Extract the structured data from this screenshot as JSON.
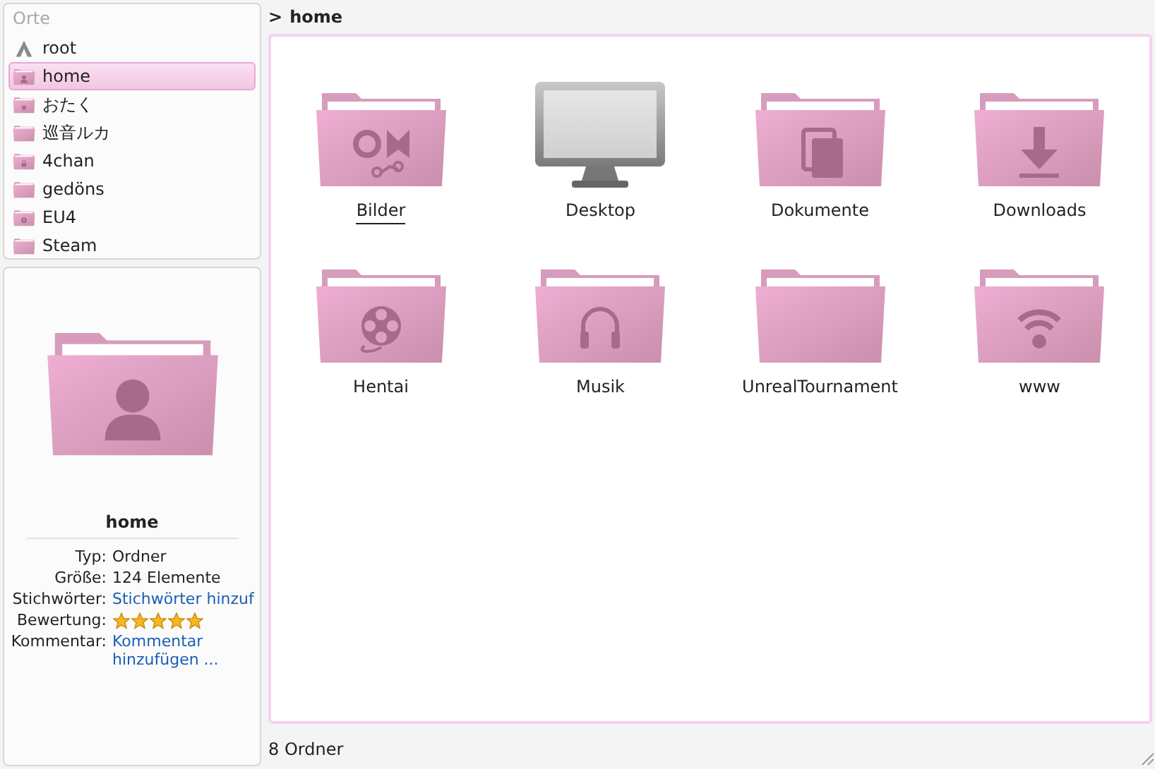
{
  "places": {
    "title": "Orte",
    "items": [
      {
        "label": "root",
        "kind": "drive",
        "selected": false
      },
      {
        "label": "home",
        "kind": "home",
        "selected": true
      },
      {
        "label": "おたく",
        "kind": "star",
        "selected": false
      },
      {
        "label": "巡音ルカ",
        "kind": "plain",
        "selected": false
      },
      {
        "label": "4chan",
        "kind": "lock",
        "selected": false
      },
      {
        "label": "gedöns",
        "kind": "plain",
        "selected": false
      },
      {
        "label": "EU4",
        "kind": "disc",
        "selected": false
      },
      {
        "label": "Steam",
        "kind": "plain",
        "selected": false
      }
    ]
  },
  "info": {
    "title": "home",
    "kind": "home",
    "rows": [
      {
        "label": "Typ:",
        "kind": "text",
        "value": "Ordner"
      },
      {
        "label": "Größe:",
        "kind": "text",
        "value": "124 Elemente"
      },
      {
        "label": "Stichwörter:",
        "kind": "link",
        "value": "Stichwörter hinzuf"
      },
      {
        "label": "Bewertung:",
        "kind": "stars",
        "stars": 5
      },
      {
        "label": "Kommentar:",
        "kind": "link",
        "value": "Kommentar hinzufügen ..."
      }
    ]
  },
  "breadcrumb": {
    "separator": ">",
    "path": "home"
  },
  "items": [
    {
      "label": "Bilder",
      "kind": "pictures",
      "focused": true
    },
    {
      "label": "Desktop",
      "kind": "desktop",
      "focused": false
    },
    {
      "label": "Dokumente",
      "kind": "documents",
      "focused": false
    },
    {
      "label": "Downloads",
      "kind": "downloads",
      "focused": false
    },
    {
      "label": "Hentai",
      "kind": "videos",
      "focused": false
    },
    {
      "label": "Musik",
      "kind": "music",
      "focused": false
    },
    {
      "label": "UnrealTournament",
      "kind": "plain",
      "focused": false
    },
    {
      "label": "www",
      "kind": "network",
      "focused": false
    }
  ],
  "status_bar": {
    "text": "8 Ordner"
  }
}
